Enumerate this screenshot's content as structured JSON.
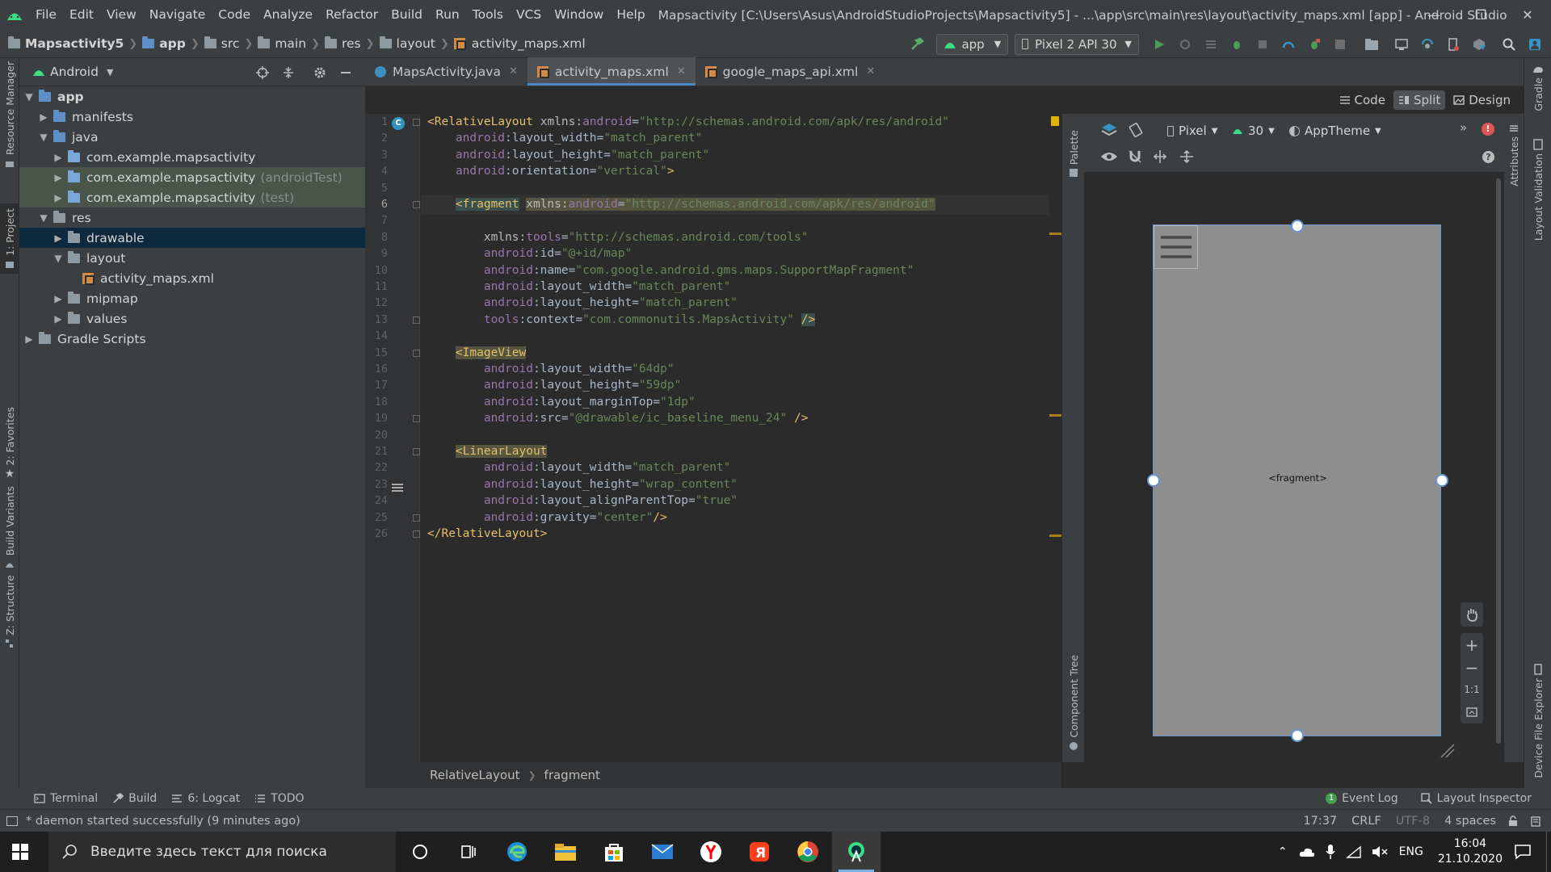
{
  "menubar": {
    "items": [
      "File",
      "Edit",
      "View",
      "Navigate",
      "Code",
      "Analyze",
      "Refactor",
      "Build",
      "Run",
      "Tools",
      "VCS",
      "Window",
      "Help"
    ],
    "window_title": "Mapsactivity [C:\\Users\\Asus\\AndroidStudioProjects\\Mapsactivity5] - ...\\app\\src\\main\\res\\layout\\activity_maps.xml [app] - Android Studio"
  },
  "navbar": {
    "breadcrumbs": [
      "Mapsactivity5",
      "app",
      "src",
      "main",
      "res",
      "layout",
      "activity_maps.xml"
    ],
    "run_config": "app",
    "device": "Pixel 2 API 30"
  },
  "left_strip": {
    "tabs": [
      "Resource Manager",
      "1: Project",
      "2: Favorites",
      "Build Variants",
      "Z: Structure"
    ]
  },
  "project_panel": {
    "view": "Android",
    "tree": [
      {
        "label": "app",
        "indent": 0,
        "arrow": "down",
        "icon": "app"
      },
      {
        "label": "manifests",
        "indent": 1,
        "arrow": "right",
        "icon": "folder-blue"
      },
      {
        "label": "java",
        "indent": 1,
        "arrow": "down",
        "icon": "folder-blue"
      },
      {
        "label": "com.example.mapsactivity",
        "indent": 2,
        "arrow": "right",
        "icon": "package",
        "suffix": ""
      },
      {
        "label": "com.example.mapsactivity",
        "indent": 2,
        "arrow": "right",
        "icon": "package",
        "suffix": "(androidTest)"
      },
      {
        "label": "com.example.mapsactivity",
        "indent": 2,
        "arrow": "right",
        "icon": "package",
        "suffix": "(test)"
      },
      {
        "label": "res",
        "indent": 1,
        "arrow": "down",
        "icon": "folder-res"
      },
      {
        "label": "drawable",
        "indent": 2,
        "arrow": "right",
        "icon": "folder-gray"
      },
      {
        "label": "layout",
        "indent": 2,
        "arrow": "down",
        "icon": "folder-gray"
      },
      {
        "label": "activity_maps.xml",
        "indent": 3,
        "arrow": "",
        "icon": "xml"
      },
      {
        "label": "mipmap",
        "indent": 2,
        "arrow": "right",
        "icon": "folder-gray"
      },
      {
        "label": "values",
        "indent": 2,
        "arrow": "right",
        "icon": "folder-gray"
      },
      {
        "label": "Gradle Scripts",
        "indent": 0,
        "arrow": "right",
        "icon": "gradle"
      }
    ],
    "selected": "drawable"
  },
  "editor_tabs": [
    {
      "label": "MapsActivity.java",
      "active": false
    },
    {
      "label": "activity_maps.xml",
      "active": true
    },
    {
      "label": "google_maps_api.xml",
      "active": false
    }
  ],
  "view_modes": [
    "Code",
    "Split",
    "Design"
  ],
  "code": {
    "current_line": 6,
    "lines": [
      [
        [
          "t-tag",
          "<RelativeLayout "
        ],
        [
          "t-attr",
          "xmlns:"
        ],
        [
          "t-ns",
          "android"
        ],
        [
          "t-plain",
          "="
        ],
        [
          "t-val",
          "\"http://schemas.android.com/apk/res/android\""
        ]
      ],
      [
        [
          "t-plain",
          "    "
        ],
        [
          "t-ns",
          "android"
        ],
        [
          "t-plain",
          ":layout_width="
        ],
        [
          "t-val",
          "\"match_parent\""
        ]
      ],
      [
        [
          "t-plain",
          "    "
        ],
        [
          "t-ns",
          "android"
        ],
        [
          "t-plain",
          ":layout_height="
        ],
        [
          "t-val",
          "\"match_parent\""
        ]
      ],
      [
        [
          "t-plain",
          "    "
        ],
        [
          "t-ns",
          "android"
        ],
        [
          "t-plain",
          ":orientation="
        ],
        [
          "t-val",
          "\"vertical\""
        ],
        [
          "t-tag",
          ">"
        ]
      ],
      [],
      [
        [
          "t-plain",
          "    "
        ],
        [
          "t-tag hl-tag",
          "<fragment"
        ],
        [
          "t-plain",
          " "
        ],
        [
          "t-attr hl-attr",
          "xmlns:"
        ],
        [
          "t-ns hl-attr",
          "android"
        ],
        [
          "t-plain hl-attr",
          "="
        ],
        [
          "t-val hl-attr",
          "\"http://schemas.android.com/apk/res/android\""
        ]
      ],
      [],
      [
        [
          "t-plain",
          "        "
        ],
        [
          "t-attr",
          "xmlns:"
        ],
        [
          "t-ns",
          "tools"
        ],
        [
          "t-plain",
          "="
        ],
        [
          "t-val",
          "\"http://schemas.android.com/tools\""
        ]
      ],
      [
        [
          "t-plain",
          "        "
        ],
        [
          "t-ns",
          "android"
        ],
        [
          "t-plain",
          ":id="
        ],
        [
          "t-val",
          "\"@+id/map\""
        ]
      ],
      [
        [
          "t-plain",
          "        "
        ],
        [
          "t-ns",
          "android"
        ],
        [
          "t-plain",
          ":name="
        ],
        [
          "t-val",
          "\"com.google.android.gms.maps.SupportMapFragment\""
        ]
      ],
      [
        [
          "t-plain",
          "        "
        ],
        [
          "t-ns",
          "android"
        ],
        [
          "t-plain",
          ":layout_width="
        ],
        [
          "t-val",
          "\"match_parent\""
        ]
      ],
      [
        [
          "t-plain",
          "        "
        ],
        [
          "t-ns",
          "android"
        ],
        [
          "t-plain",
          ":layout_height="
        ],
        [
          "t-val",
          "\"match_parent\""
        ]
      ],
      [
        [
          "t-plain",
          "        "
        ],
        [
          "t-ns",
          "tools"
        ],
        [
          "t-plain",
          ":context="
        ],
        [
          "t-val",
          "\"com.commonutils.MapsActivity\""
        ],
        [
          "t-plain",
          " "
        ],
        [
          "t-tag hl-tag",
          "/>"
        ]
      ],
      [],
      [
        [
          "t-plain",
          "    "
        ],
        [
          "t-tag hl-attr",
          "<ImageView"
        ]
      ],
      [
        [
          "t-plain",
          "        "
        ],
        [
          "t-ns",
          "android"
        ],
        [
          "t-plain",
          ":layout_width="
        ],
        [
          "t-val",
          "\"64dp\""
        ]
      ],
      [
        [
          "t-plain",
          "        "
        ],
        [
          "t-ns",
          "android"
        ],
        [
          "t-plain",
          ":layout_height="
        ],
        [
          "t-val",
          "\"59dp\""
        ]
      ],
      [
        [
          "t-plain",
          "        "
        ],
        [
          "t-ns",
          "android"
        ],
        [
          "t-plain",
          ":layout_marginTop="
        ],
        [
          "t-val",
          "\"1dp\""
        ]
      ],
      [
        [
          "t-plain",
          "        "
        ],
        [
          "t-ns",
          "android"
        ],
        [
          "t-plain",
          ":src="
        ],
        [
          "t-val",
          "\"@drawable/ic_baseline_menu_24\""
        ],
        [
          "t-plain",
          " "
        ],
        [
          "t-tag",
          "/>"
        ]
      ],
      [],
      [
        [
          "t-plain",
          "    "
        ],
        [
          "t-tag hl-attr",
          "<LinearLayout"
        ]
      ],
      [
        [
          "t-plain",
          "        "
        ],
        [
          "t-ns",
          "android"
        ],
        [
          "t-plain",
          ":layout_width="
        ],
        [
          "t-val",
          "\"match_parent\""
        ]
      ],
      [
        [
          "t-plain",
          "        "
        ],
        [
          "t-ns",
          "android"
        ],
        [
          "t-plain",
          ":layout_height="
        ],
        [
          "t-val",
          "\"wrap_content\""
        ]
      ],
      [
        [
          "t-plain",
          "        "
        ],
        [
          "t-ns",
          "android"
        ],
        [
          "t-plain",
          ":layout_alignParentTop="
        ],
        [
          "t-val",
          "\"true\""
        ]
      ],
      [
        [
          "t-plain",
          "        "
        ],
        [
          "t-ns",
          "android"
        ],
        [
          "t-plain",
          ":gravity="
        ],
        [
          "t-val",
          "\"center\""
        ],
        [
          "t-tag",
          "/>"
        ]
      ],
      [
        [
          "t-tag",
          "</RelativeLayout>"
        ]
      ]
    ]
  },
  "palette_strip": {
    "palette": "Palette",
    "component_tree": "Component Tree"
  },
  "preview": {
    "device": "Pixel",
    "api": "30",
    "theme": "AppTheme",
    "fragment_label": "<fragment>",
    "zoom_fit": "1:1"
  },
  "attr_strip": {
    "attributes": "Attributes"
  },
  "far_right": {
    "tabs": [
      "Gradle",
      "Layout Validation",
      "Device File Explorer"
    ]
  },
  "editor_crumbs": [
    "RelativeLayout",
    "fragment"
  ],
  "bottom_tabs": {
    "left": [
      "Terminal",
      "Build",
      "6: Logcat",
      "TODO"
    ],
    "right": [
      "Event Log",
      "Layout Inspector"
    ],
    "event_count": "1"
  },
  "status": {
    "message": "* daemon started successfully (9 minutes ago)",
    "position": "17:37",
    "line_sep": "CRLF",
    "encoding": "UTF-8",
    "indent": "4 spaces"
  },
  "taskbar": {
    "search_placeholder": "Введите здесь текст для поиска",
    "lang": "ENG",
    "time": "16:04",
    "date": "21.10.2020"
  }
}
